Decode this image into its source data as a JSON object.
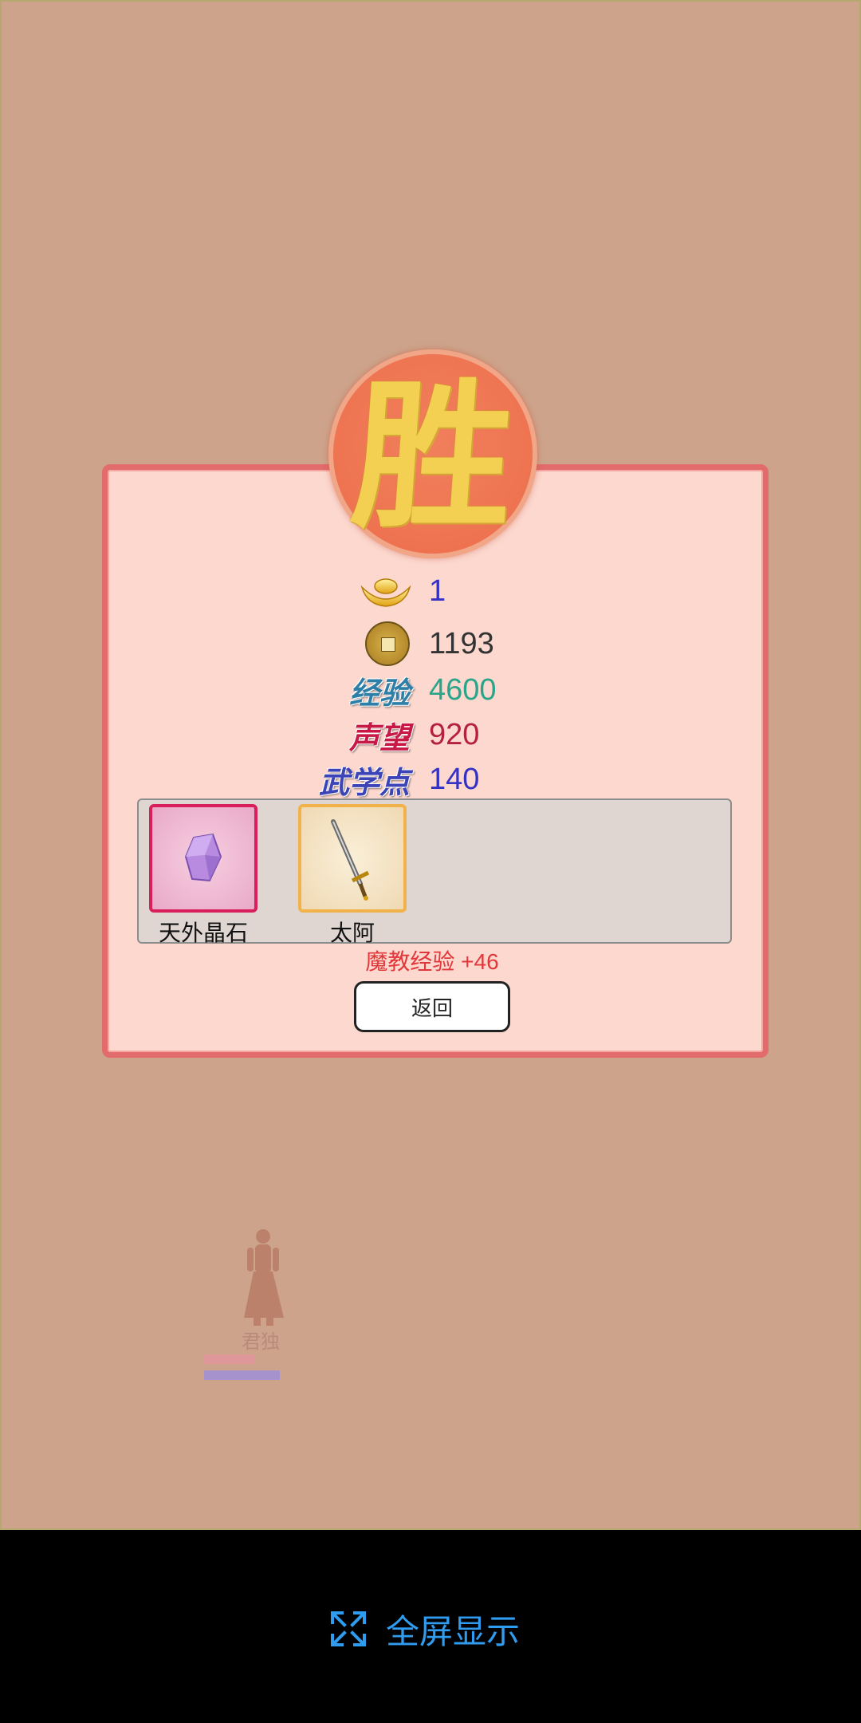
{
  "result": {
    "title_glyph": "胜"
  },
  "rewards": {
    "ingot": {
      "icon": "gold-ingot-icon",
      "value": "1",
      "color": "#3431c4"
    },
    "coins": {
      "icon": "copper-coin-icon",
      "value": "1193",
      "color": "#333333"
    },
    "experience": {
      "label": "经验",
      "value": "4600",
      "color": "#2ba58a"
    },
    "reputation": {
      "label": "声望",
      "value": "920",
      "color": "#b3213f"
    },
    "martial_points": {
      "label": "武学点",
      "value": "140",
      "color": "#3431c4"
    }
  },
  "items": [
    {
      "name": "天外晶石",
      "icon": "crystal-icon",
      "frame_color": "#d81f5c"
    },
    {
      "name": "太阿",
      "icon": "sword-icon",
      "frame_color": "#f2b24a"
    }
  ],
  "bonus_text": "魔教经验 +46",
  "back_button_label": "返回",
  "player": {
    "name": "君独"
  },
  "fullscreen": {
    "label": "全屏显示",
    "icon": "expand-icon",
    "color": "#2f9cf0"
  }
}
